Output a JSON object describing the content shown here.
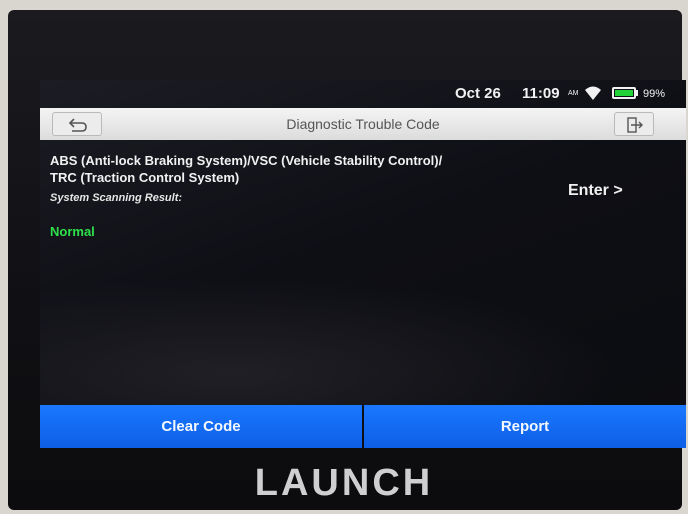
{
  "status_bar": {
    "date": "Oct 26",
    "time": "11:09",
    "ampm": "AM",
    "battery": "99%"
  },
  "header": {
    "title": "Diagnostic Trouble Code"
  },
  "system": {
    "name_line1": "ABS (Anti-lock Braking System)/VSC (Vehicle Stability Control)/",
    "name_line2": "TRC (Traction Control System)",
    "scan_label": "System Scanning Result:",
    "scan_result": "Normal",
    "enter_label": "Enter >"
  },
  "footer": {
    "clear_code_label": "Clear Code",
    "report_label": "Report"
  },
  "device": {
    "brand": "LAUNCH"
  },
  "colors": {
    "accent_blue": "#1a78ff",
    "result_green": "#2fe04b",
    "battery_green": "#22d43a"
  },
  "icons": [
    "back-arrow-icon",
    "exit-icon",
    "wifi-icon",
    "battery-icon"
  ]
}
